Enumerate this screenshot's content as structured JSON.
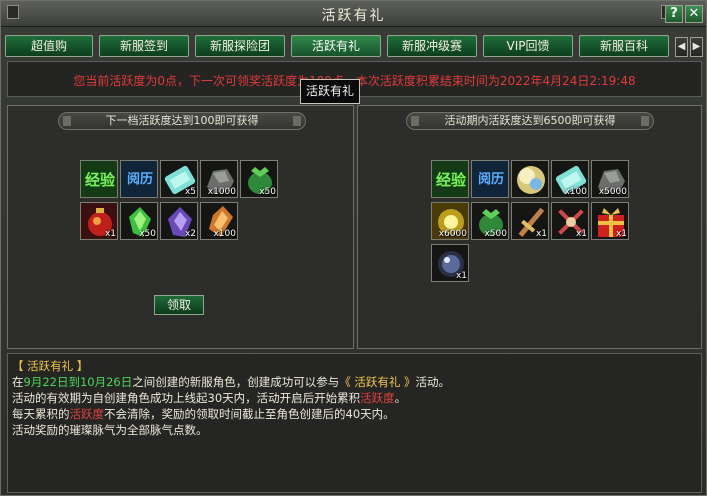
{
  "window": {
    "title": "活跃有礼",
    "help_label": "?",
    "close_label": "✕"
  },
  "tabs": [
    {
      "label": "超值购"
    },
    {
      "label": "新服签到"
    },
    {
      "label": "新服探险团"
    },
    {
      "label": "活跃有礼"
    },
    {
      "label": "新服冲级赛"
    },
    {
      "label": "VIP回馈"
    },
    {
      "label": "新服百科"
    }
  ],
  "nav": {
    "prev": "◀",
    "next": "▶"
  },
  "notice": {
    "text": "您当前活跃度为0点，下一次可领奖活跃度为100点，本次活跃度积累结束时间为2022年4月24日2:19:48"
  },
  "tooltip": {
    "text": "活跃有礼"
  },
  "left_panel": {
    "header": "下一档活跃度达到100即可获得",
    "row1": [
      {
        "icon": "exp-icon",
        "label": "经验",
        "qty": ""
      },
      {
        "icon": "lingli-icon",
        "label": "阅历",
        "qty": ""
      },
      {
        "icon": "ticket-icon",
        "label": "",
        "qty": "x5"
      },
      {
        "icon": "ore-icon",
        "label": "",
        "qty": "x1000"
      },
      {
        "icon": "herb-bag-icon",
        "label": "",
        "qty": "x50"
      }
    ],
    "row2": [
      {
        "icon": "red-pouch-icon",
        "label": "",
        "qty": "x1"
      },
      {
        "icon": "green-gem-icon",
        "label": "",
        "qty": "x50"
      },
      {
        "icon": "purple-gem-icon",
        "label": "",
        "qty": "x2"
      },
      {
        "icon": "orange-gem-icon",
        "label": "",
        "qty": "x100"
      }
    ],
    "claim_label": "领取"
  },
  "right_panel": {
    "header": "活动期内活跃度达到6500即可获得",
    "row1": [
      {
        "icon": "exp-icon",
        "label": "经验",
        "qty": ""
      },
      {
        "icon": "lingli-icon",
        "label": "阅历",
        "qty": ""
      },
      {
        "icon": "spirit-orb-icon",
        "label": "",
        "qty": ""
      },
      {
        "icon": "ticket-icon",
        "label": "",
        "qty": "x100"
      },
      {
        "icon": "ore-icon",
        "label": "",
        "qty": "x5000"
      }
    ],
    "row2": [
      {
        "icon": "gold-sparkle-icon",
        "label": "",
        "qty": "x6000"
      },
      {
        "icon": "herb-bag-icon",
        "label": "",
        "qty": "x500"
      },
      {
        "icon": "sword-icon",
        "label": "",
        "qty": "x1"
      },
      {
        "icon": "crossed-blades-icon",
        "label": "",
        "qty": "x1"
      },
      {
        "icon": "gift-box-icon",
        "label": "",
        "qty": "x1"
      }
    ],
    "row3": [
      {
        "icon": "dark-orb-icon",
        "label": "",
        "qty": "x1"
      }
    ]
  },
  "description": {
    "title": "【 活跃有礼 】",
    "line1": {
      "a": "在",
      "b": "9月22日到10月26日",
      "c": "之间创建的新服角色，创建成功可以参与",
      "d": "《 活跃有礼 》",
      "e": "活动。"
    },
    "line2": {
      "a": "活动的有效期为自创建角色成功上线起30天内，活动开启后开始累积",
      "b": "活跃度",
      "c": "。"
    },
    "line3": {
      "a": "每天累积的",
      "b": "活跃度",
      "c": "不会清除，奖励的领取时间截止至角色创建后的40天内。"
    },
    "line4": {
      "a": "活动奖励的璀璨脉气为全部脉气点数。"
    }
  }
}
